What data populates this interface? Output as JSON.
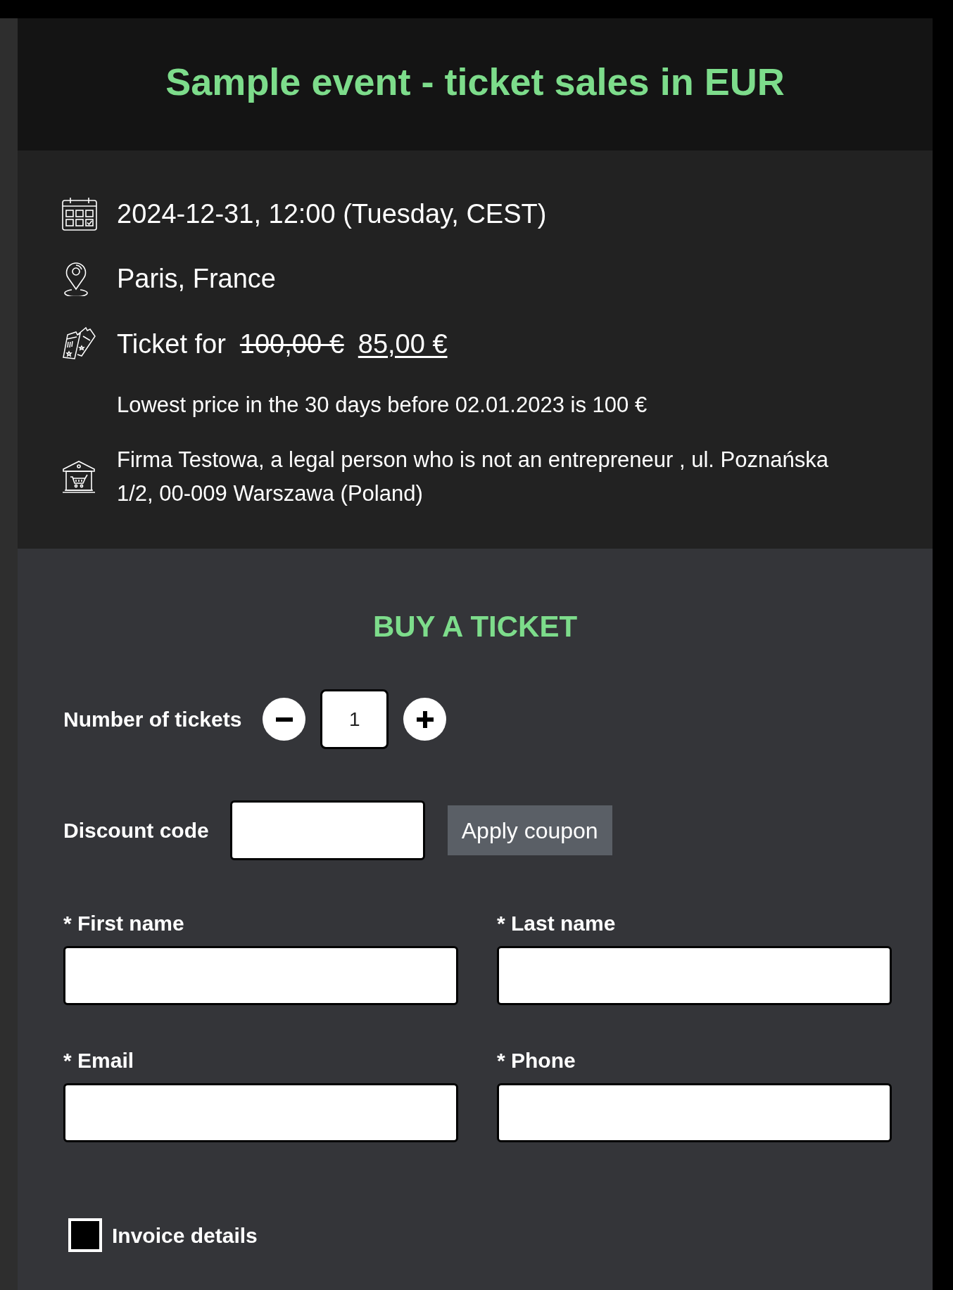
{
  "header": {
    "title": "Sample event - ticket sales in EUR"
  },
  "details": [
    {
      "kind": "date",
      "text": "2024-12-31, 12:00 (Tuesday, CEST)"
    },
    {
      "kind": "location",
      "text": "Paris, France"
    },
    {
      "kind": "price",
      "label": "Ticket for",
      "old_price": "100,00 €",
      "price": "85,00 €"
    },
    {
      "kind": "note",
      "text": "Lowest price in the 30 days before 02.01.2023 is 100 €"
    },
    {
      "kind": "organizer",
      "text": "Firma Testowa, a legal person who is not an entrepreneur , ul. Poznańska 1/2, 00-009 Warszawa (Poland)"
    }
  ],
  "form": {
    "title": "BUY A TICKET",
    "quantity": {
      "label": "Number of tickets",
      "value": "1"
    },
    "discount": {
      "label": "Discount code",
      "button": "Apply coupon"
    },
    "fields": [
      {
        "label": "* First name"
      },
      {
        "label": "* Last name"
      },
      {
        "label": "* Email"
      },
      {
        "label": "* Phone"
      }
    ],
    "invoice": {
      "label": "Invoice details",
      "checked": false
    }
  }
}
